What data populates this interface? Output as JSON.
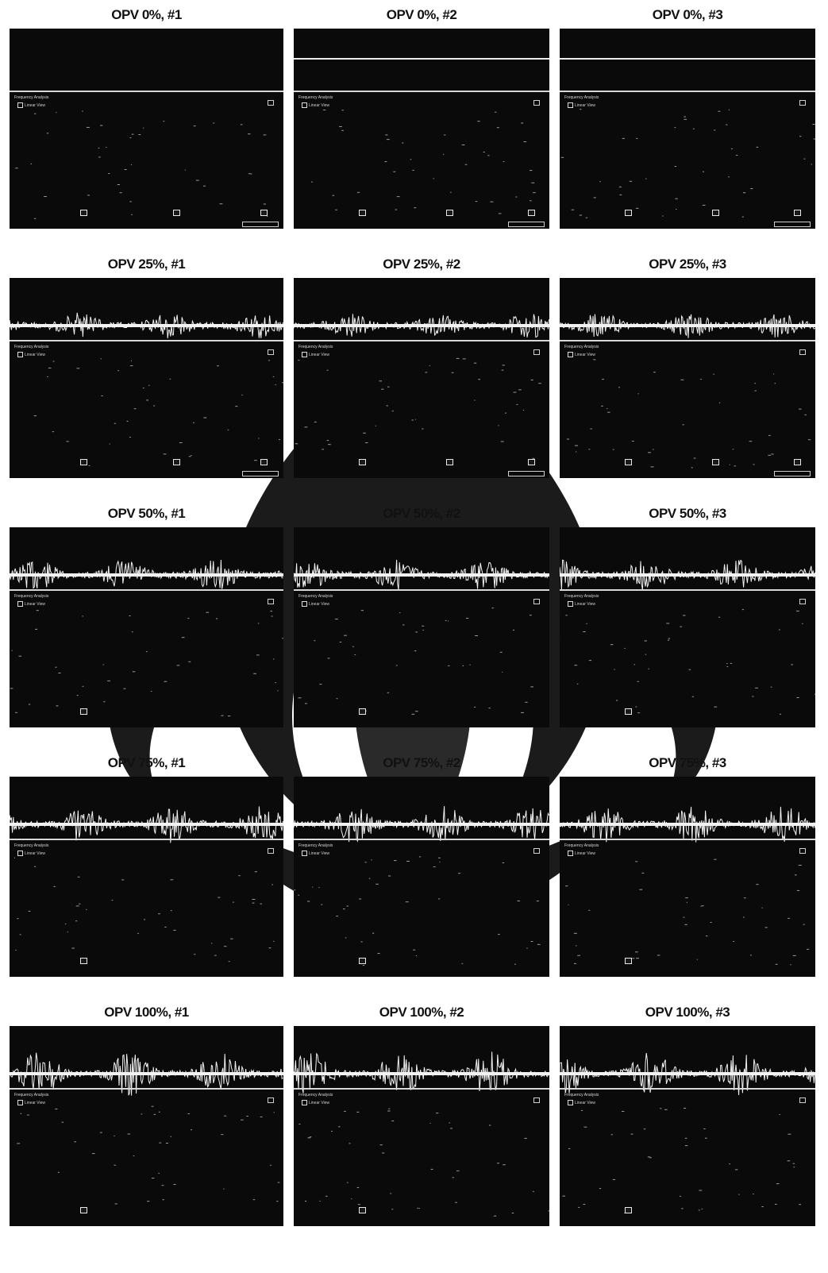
{
  "screenshots": [
    {
      "label": "OPV 0%, #1",
      "level": 0,
      "trial": 1,
      "top_line": false,
      "bottom_buttons": 3
    },
    {
      "label": "OPV 0%, #2",
      "level": 0,
      "trial": 2,
      "top_line": true,
      "bottom_buttons": 3
    },
    {
      "label": "OPV 0%, #3",
      "level": 0,
      "trial": 3,
      "top_line": true,
      "bottom_buttons": 3
    },
    {
      "label": "OPV 25%, #1",
      "level": 25,
      "trial": 1,
      "top_line": false,
      "bottom_buttons": 3
    },
    {
      "label": "OPV 25%, #2",
      "level": 25,
      "trial": 2,
      "top_line": false,
      "bottom_buttons": 3
    },
    {
      "label": "OPV 25%, #3",
      "level": 25,
      "trial": 3,
      "top_line": false,
      "bottom_buttons": 3
    },
    {
      "label": "OPV 50%, #1",
      "level": 50,
      "trial": 1,
      "top_line": false,
      "bottom_buttons": 1
    },
    {
      "label": "OPV 50%, #2",
      "level": 50,
      "trial": 2,
      "top_line": false,
      "bottom_buttons": 1
    },
    {
      "label": "OPV 50%, #3",
      "level": 50,
      "trial": 3,
      "top_line": false,
      "bottom_buttons": 1
    },
    {
      "label": "OPV 75%, #1",
      "level": 75,
      "trial": 1,
      "top_line": false,
      "bottom_buttons": 1
    },
    {
      "label": "OPV 75%, #2",
      "level": 75,
      "trial": 2,
      "top_line": false,
      "bottom_buttons": 1
    },
    {
      "label": "OPV 75%, #3",
      "level": 75,
      "trial": 3,
      "top_line": false,
      "bottom_buttons": 1
    },
    {
      "label": "OPV 100%, #1",
      "level": 100,
      "trial": 1,
      "top_line": false,
      "bottom_buttons": 1
    },
    {
      "label": "OPV 100%, #2",
      "level": 100,
      "trial": 2,
      "top_line": false,
      "bottom_buttons": 1
    },
    {
      "label": "OPV 100%, #3",
      "level": 100,
      "trial": 3,
      "top_line": false,
      "bottom_buttons": 1
    }
  ],
  "panel_text": {
    "section_title": "Frequency Analysis",
    "checkbox_label": "Linear View"
  },
  "colors": {
    "screen_bg": "#0a0a0a",
    "trace": "#f2f2f2",
    "ui_text": "#d8d8d8",
    "watermark": "#1b1b1b"
  },
  "icons": [
    "checkbox-icon",
    "watermark-emblem-icon"
  ]
}
